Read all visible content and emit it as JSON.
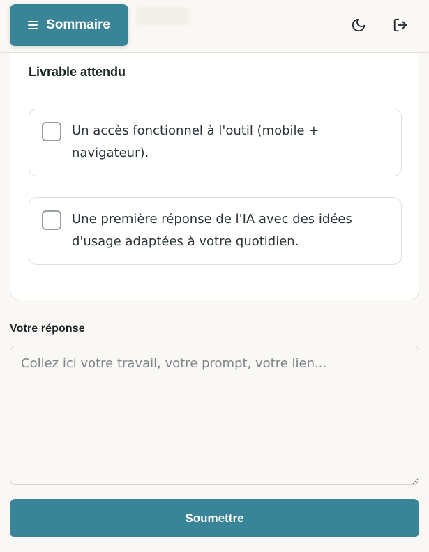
{
  "header": {
    "menu_button_label": "Sommaire",
    "menu_icon": "hamburger-icon",
    "theme_icon": "moon-icon",
    "logout_icon": "logout-icon"
  },
  "deliverable": {
    "title": "Livrable attendu",
    "items": [
      {
        "text": "Un accès fonctionnel à l'outil (mobile + navigateur).",
        "checked": false
      },
      {
        "text": "Une première réponse de l'IA avec des idées d'usage adaptées à votre quotidien.",
        "checked": false
      }
    ]
  },
  "answer": {
    "label": "Votre réponse",
    "placeholder": "Collez ici votre travail, votre prompt, votre lien...",
    "value": ""
  },
  "submit": {
    "label": "Soumettre"
  },
  "colors": {
    "accent": "#3a8497",
    "background": "#faf8f4",
    "card": "#ffffff",
    "border": "#e2ded6"
  }
}
